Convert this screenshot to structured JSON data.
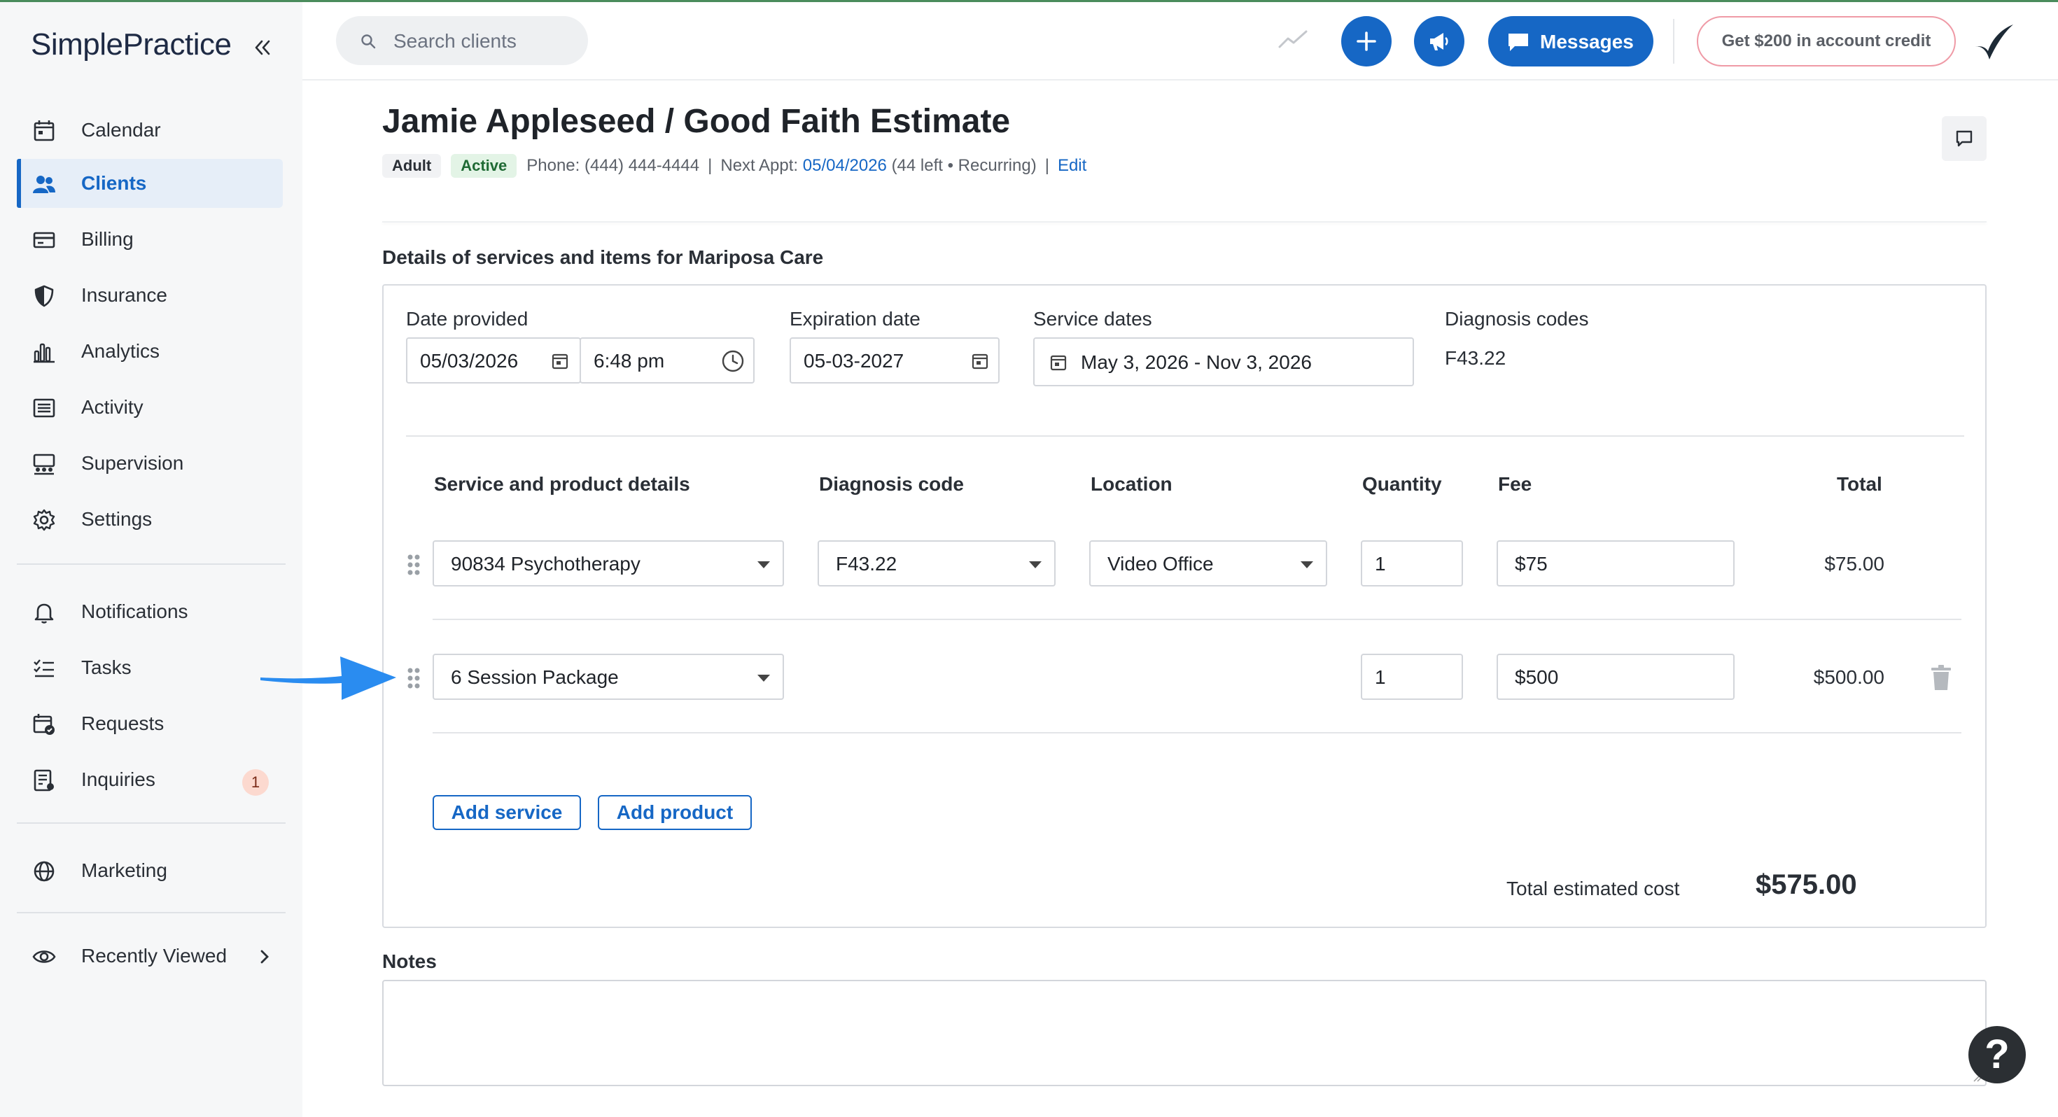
{
  "app": {
    "logo": "SimplePractice"
  },
  "sidebar": {
    "items": [
      {
        "label": "Calendar",
        "icon": "calendar-icon"
      },
      {
        "label": "Clients",
        "icon": "clients-icon",
        "active": true
      },
      {
        "label": "Billing",
        "icon": "billing-icon"
      },
      {
        "label": "Insurance",
        "icon": "shield-icon"
      },
      {
        "label": "Analytics",
        "icon": "analytics-icon"
      },
      {
        "label": "Activity",
        "icon": "activity-icon"
      },
      {
        "label": "Supervision",
        "icon": "supervision-icon"
      },
      {
        "label": "Settings",
        "icon": "gear-icon"
      },
      {
        "label": "Notifications",
        "icon": "bell-icon"
      },
      {
        "label": "Tasks",
        "icon": "tasks-icon"
      },
      {
        "label": "Requests",
        "icon": "requests-icon"
      },
      {
        "label": "Inquiries",
        "icon": "inquiries-icon",
        "badge": "1"
      },
      {
        "label": "Marketing",
        "icon": "globe-icon"
      },
      {
        "label": "Recently Viewed",
        "icon": "eye-icon"
      }
    ]
  },
  "topbar": {
    "search_placeholder": "Search clients",
    "messages_label": "Messages",
    "credit_label": "Get $200 in account credit"
  },
  "header": {
    "title": "Jamie Appleseed / Good Faith Estimate",
    "tags": [
      "Adult",
      "Active"
    ],
    "phone_label": "Phone:",
    "phone": "(444) 444-4444",
    "next_appt_label": "Next Appt:",
    "next_appt_date": "05/04/2026",
    "next_appt_note": "(44 left • Recurring)",
    "edit_label": "Edit"
  },
  "details": {
    "section_title": "Details of services and items for Mariposa Care",
    "date_provided_label": "Date provided",
    "date_provided": "05/03/2026",
    "time_provided": "6:48 pm",
    "expiration_label": "Expiration date",
    "expiration_date": "05-03-2027",
    "service_dates_label": "Service dates",
    "service_dates": "May 3, 2026 - Nov 3, 2026",
    "diagnosis_codes_label": "Diagnosis codes",
    "diagnosis_codes": "F43.22"
  },
  "table": {
    "headers": [
      "Service and product details",
      "Diagnosis code",
      "Location",
      "Quantity",
      "Fee",
      "Total"
    ],
    "rows": [
      {
        "service": "90834 Psychotherapy",
        "diagnosis": "F43.22",
        "location": "Video Office",
        "quantity": "1",
        "fee": "$75",
        "total": "$75.00"
      },
      {
        "service": "6 Session Package",
        "quantity": "1",
        "fee": "$500",
        "total": "$500.00"
      }
    ]
  },
  "actions": {
    "add_service": "Add service",
    "add_product": "Add product"
  },
  "totals": {
    "label": "Total estimated cost",
    "value": "$575.00"
  },
  "notes": {
    "label": "Notes"
  },
  "help": {
    "label": "?"
  },
  "colors": {
    "accent": "#1667c5",
    "arrow": "#2a8cf0",
    "active_tag": "#1f6a34"
  }
}
